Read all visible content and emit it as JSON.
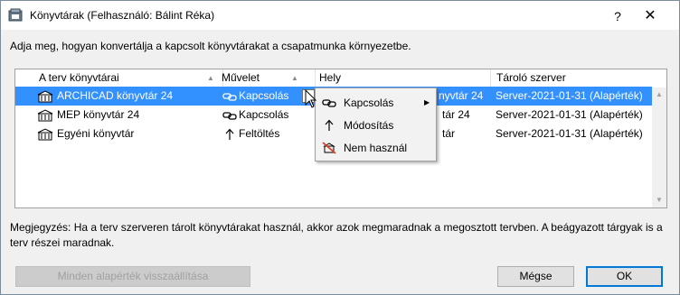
{
  "window": {
    "title": "Könyvtárak (Felhasználó: Bálint Réka)",
    "help_glyph": "?",
    "close_glyph": "✕"
  },
  "instruction": "Adja meg, hogyan konvertálja a kapcsolt könyvtárakat a csapatmunka környezetbe.",
  "table": {
    "columns": [
      "A terv könyvtárai",
      "Művelet",
      "Hely",
      "Tároló szerver"
    ],
    "rows": [
      {
        "name": "ARCHICAD könyvtár 24",
        "action": "Kapcsolás",
        "action_icon": "link-icon",
        "location": "nyvtár 24",
        "server": "Server-2021-01-31 (Alapérték)",
        "selected": true
      },
      {
        "name": "MEP könyvtár 24",
        "action": "Kapcsolás",
        "action_icon": "link-icon",
        "location": "tár 24",
        "server": "Server-2021-01-31 (Alapérték)",
        "selected": false
      },
      {
        "name": "Egyéni könyvtár",
        "action": "Feltöltés",
        "action_icon": "upload-arrow-icon",
        "location": "tár",
        "server": "Server-2021-01-31 (Alapérték)",
        "selected": false
      }
    ]
  },
  "context_menu": {
    "items": [
      {
        "label": "Kapcsolás",
        "icon": "link-icon",
        "has_submenu": true,
        "submenu_glyph": "▶"
      },
      {
        "label": "Módosítás",
        "icon": "upload-arrow-icon",
        "has_submenu": false
      },
      {
        "label": "Nem használ",
        "icon": "not-used-icon",
        "has_submenu": false
      }
    ]
  },
  "note": "Megjegyzés: Ha a terv szerveren tárolt könyvtárakat használ, akkor azok megmaradnak a megosztott tervben. A beágyazott tárgyak is a terv részei maradnak.",
  "buttons": {
    "reset": "Minden alapérték visszaállítása",
    "cancel": "Mégse",
    "ok": "OK"
  },
  "colors": {
    "selection": "#3390ff",
    "default_button_border": "#0078d7"
  }
}
